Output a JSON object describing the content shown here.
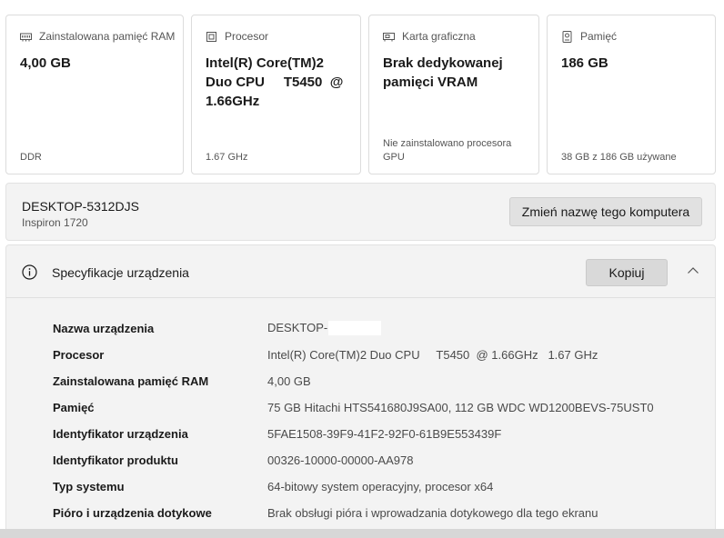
{
  "cards": [
    {
      "title": "Zainstalowana pamięć RAM",
      "icon": "ram-icon",
      "value": "4,00 GB",
      "foot": "DDR"
    },
    {
      "title": "Procesor",
      "icon": "cpu-icon",
      "value": "Intel(R) Core(TM)2 Duo CPU     T5450  @ 1.66GHz",
      "foot": "1.67 GHz"
    },
    {
      "title": "Karta graficzna",
      "icon": "gpu-icon",
      "value": "Brak dedykowanej pamięci VRAM",
      "foot": "Nie zainstalowano procesora GPU"
    },
    {
      "title": "Pamięć",
      "icon": "storage-icon",
      "value": "186 GB",
      "foot": "38 GB z 186 GB używane"
    }
  ],
  "computer": {
    "name": "DESKTOP-5312DJS",
    "model": "Inspiron 1720",
    "rename_label": "Zmień nazwę tego komputera"
  },
  "specs": {
    "title": "Specyfikacje urządzenia",
    "copy_label": "Kopiuj",
    "rows": [
      {
        "label": "Nazwa urządzenia",
        "value": "DESKTOP-"
      },
      {
        "label": "Procesor",
        "value": "Intel(R) Core(TM)2 Duo CPU     T5450  @ 1.66GHz   1.67 GHz"
      },
      {
        "label": "Zainstalowana pamięć RAM",
        "value": "4,00 GB"
      },
      {
        "label": "Pamięć",
        "value": "75 GB Hitachi HTS541680J9SA00, 112 GB WDC WD1200BEVS-75UST0"
      },
      {
        "label": "Identyfikator urządzenia",
        "value": "5FAE1508-39F9-41F2-92F0-61B9E553439F"
      },
      {
        "label": "Identyfikator produktu",
        "value": "00326-10000-00000-AA978"
      },
      {
        "label": "Typ systemu",
        "value": "64-bitowy system operacyjny, procesor x64"
      },
      {
        "label": "Pióro i urządzenia dotykowe",
        "value": "Brak obsługi pióra i wprowadzania dotykowego dla tego ekranu"
      }
    ]
  }
}
